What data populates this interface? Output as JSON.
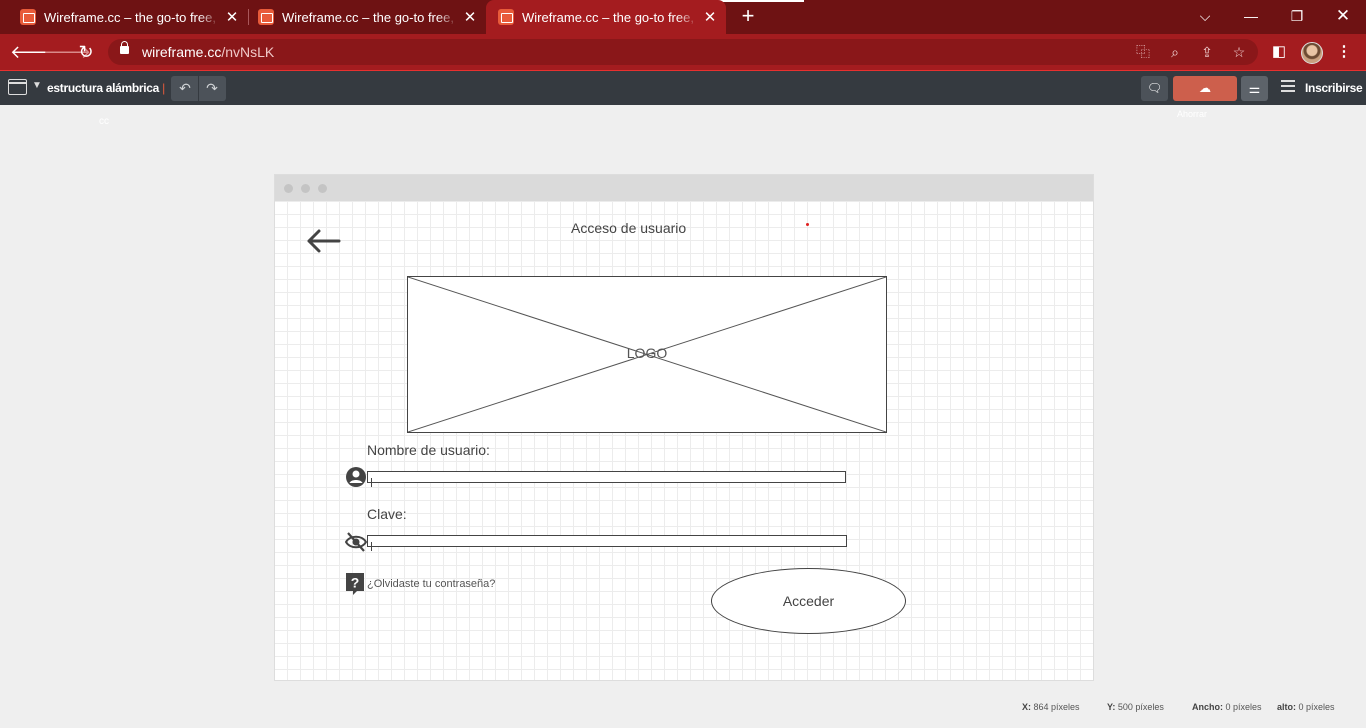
{
  "browser": {
    "tabs": [
      {
        "title": "Wireframe.cc – the go-to free, online wireframe tool",
        "active": false
      },
      {
        "title": "Wireframe.cc – the go-to free, online wireframe tool",
        "active": false
      },
      {
        "title": "Wireframe.cc – the go-to free, online wireframe tool",
        "active": true
      }
    ],
    "new_tab_label": "+",
    "url_host": "wireframe.cc",
    "url_path": "/nvNsLK",
    "accent": "#a41c1f",
    "tab_strip_color": "#6e1213"
  },
  "app": {
    "doc_title": "estructura alámbrica",
    "doc_cursor": "|",
    "logo_hint": "cc",
    "save_label": "Ahorrar",
    "signin_label": "Inscribirse",
    "save_color": "#cd5f4c"
  },
  "wireframe": {
    "title": "Acceso de usuario",
    "logo_label": "LOGO",
    "username_label": "Nombre de usuario:",
    "password_label": "Clave:",
    "forgot_label": "¿Olvidaste tu contraseña?",
    "submit_label": "Acceder"
  },
  "status": {
    "x_label": "X:",
    "x_value": "864 píxeles",
    "y_label": "Y:",
    "y_value": "500 píxeles",
    "w_label": "Ancho:",
    "w_value": "0 píxeles",
    "h_label": "alto:",
    "h_value": "0 píxeles"
  }
}
